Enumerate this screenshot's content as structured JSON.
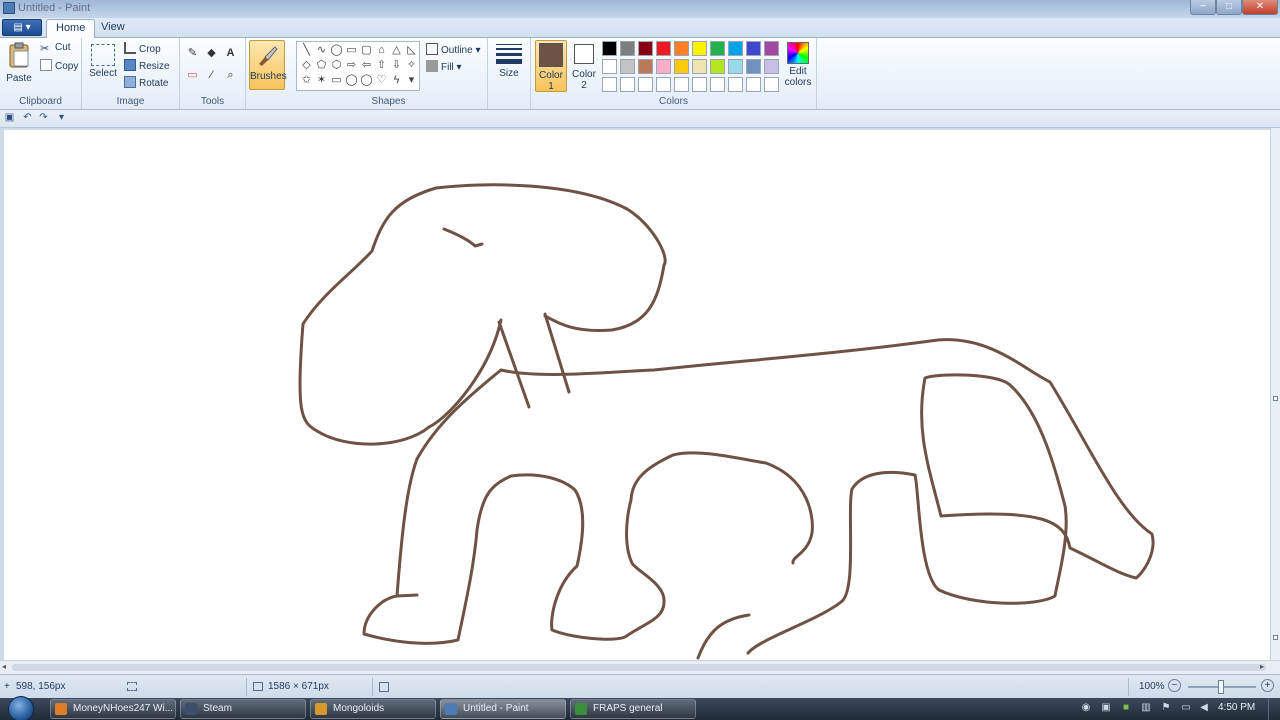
{
  "window": {
    "title": "Untitled - Paint",
    "minimize": "−",
    "maximize": "□",
    "close": "✕"
  },
  "tabs": {
    "app_menu": "▤ ▾",
    "home": "Home",
    "view": "View"
  },
  "clipboard": {
    "paste": "Paste",
    "cut": "Cut",
    "copy": "Copy",
    "label": "Clipboard"
  },
  "image": {
    "select": "Select",
    "crop": "Crop",
    "resize": "Resize",
    "rotate": "Rotate",
    "label": "Image"
  },
  "tools": {
    "label": "Tools",
    "text_tool": "A",
    "pencil": "✎",
    "fill": "◆",
    "eraser": "▭",
    "picker": "⁄",
    "magnifier": "⌕"
  },
  "brushes": {
    "label": "Brushes"
  },
  "shapes": {
    "outline": "Outline",
    "fill": "Fill",
    "label": "Shapes",
    "items": [
      "╲",
      "∿",
      "◯",
      "▭",
      "▢",
      "⌂",
      "△",
      "◺",
      "◇",
      "⬠",
      "⬡",
      "⇨",
      "⇦",
      "⇧",
      "⇩",
      "✧",
      "✩",
      "✶",
      "▭",
      "◯",
      "◯",
      "♡",
      "ϟ",
      "▾"
    ]
  },
  "size": {
    "label": "Size"
  },
  "colors": {
    "color1_label": "Color",
    "color1_num": "1",
    "color2_label": "Color",
    "color2_num": "2",
    "edit": "Edit",
    "edit2": "colors",
    "label": "Colors",
    "color1": "#6e5245",
    "color2": "#ffffff",
    "palette_row1": [
      "#000000",
      "#7f7f7f",
      "#880015",
      "#ed1c24",
      "#ff7f27",
      "#fff200",
      "#22b14c",
      "#00a2e8",
      "#3f48cc",
      "#a349a4"
    ],
    "palette_row2": [
      "#ffffff",
      "#c3c3c3",
      "#b97a57",
      "#ffaec9",
      "#ffc90e",
      "#efe4b0",
      "#b5e61d",
      "#99d9ea",
      "#7092be",
      "#c8bfe7"
    ],
    "palette_row3": [
      "#ffffff",
      "#ffffff",
      "#ffffff",
      "#ffffff",
      "#ffffff",
      "#ffffff",
      "#ffffff",
      "#ffffff",
      "#ffffff",
      "#ffffff"
    ]
  },
  "drawing": {
    "stroke": "#6e5245"
  },
  "status": {
    "cursor_pos": "598, 156px",
    "selection": "",
    "canvas_size": "1586 × 671px",
    "file_size": "",
    "zoom": "100%"
  },
  "taskbar": {
    "items": [
      "MoneyNHoes247 Wi...",
      "Steam",
      "Mongoloids",
      "Untitled - Paint",
      "FRAPS general"
    ],
    "clock": "4:50 PM"
  }
}
